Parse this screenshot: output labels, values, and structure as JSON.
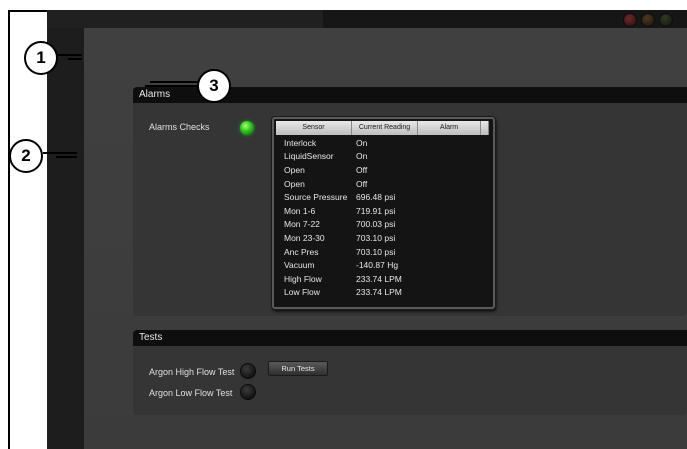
{
  "callouts": [
    "1",
    "2",
    "3"
  ],
  "alarms_panel": {
    "title": "Alarms",
    "checks_label": "Alarms Checks",
    "checks_led_color": "#2fbf1c",
    "table": {
      "headers": [
        "Sensor",
        "Current Reading",
        "Alarm"
      ],
      "rows": [
        {
          "sensor": "Interlock",
          "reading": "On"
        },
        {
          "sensor": "LiquidSensor",
          "reading": "On"
        },
        {
          "sensor": "Open",
          "reading": "Off"
        },
        {
          "sensor": "Open",
          "reading": "Off"
        },
        {
          "sensor": "Source Pressure",
          "reading": "696.48 psi"
        },
        {
          "sensor": "Mon 1-6",
          "reading": "719.91 psi"
        },
        {
          "sensor": "Mon 7-22",
          "reading": "700.03 psi"
        },
        {
          "sensor": "Mon 23-30",
          "reading": "703.10 psi"
        },
        {
          "sensor": "Anc Pres",
          "reading": "703.10 psi"
        },
        {
          "sensor": "Vacuum",
          "reading": "-140.87 Hg"
        },
        {
          "sensor": "High Flow",
          "reading": "233.74 LPM"
        },
        {
          "sensor": "Low Flow",
          "reading": "233.74 LPM"
        }
      ]
    }
  },
  "tests_panel": {
    "title": "Tests",
    "high_flow_label": "Argon High Flow Test",
    "low_flow_label": "Argon Low Flow Test",
    "run_button_label": "Run Tests"
  },
  "colors": {
    "background": "#3b3b3b",
    "panel": "#353535",
    "header": "#0e0e0e",
    "led_green": "#2fbf1c",
    "led_off": "#151515"
  }
}
